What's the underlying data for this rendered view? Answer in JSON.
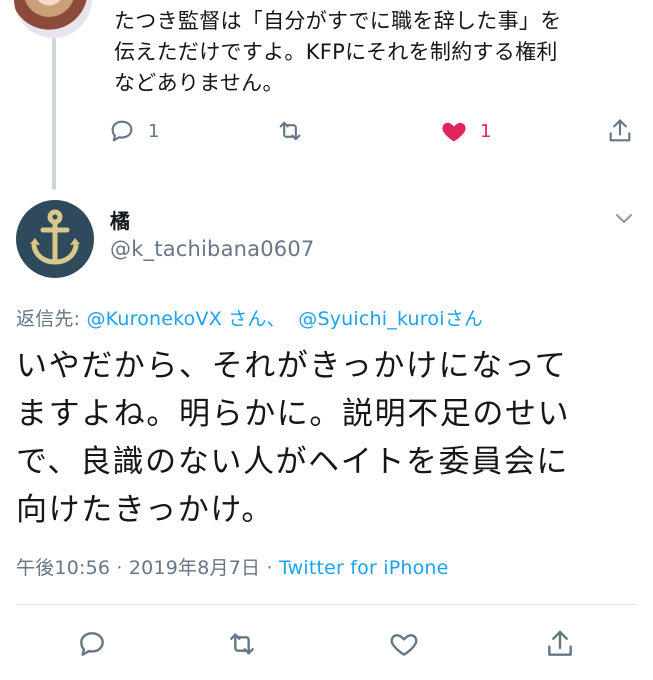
{
  "parent_tweet": {
    "text_line1": "たつき監督は「自分がすでに職を辞した事」を",
    "text_line2": "伝えただけですよ。KFPにそれを制約する権利",
    "text_line3": "などありません。",
    "reply_count": "1",
    "like_count": "1",
    "liked": true
  },
  "tweet": {
    "display_name": "橘",
    "handle": "@k_tachibana0607",
    "reply_to_prefix": "返信先: ",
    "reply_to_user1": "@KuronekoVX さん、",
    "reply_to_user2": "@Syuichi_kuroi",
    "reply_to_suffix": "さん",
    "body_line1": "いやだから、それがきっかけになって",
    "body_line2": "ますよね。明らかに。説明不足のせい",
    "body_line3": "で、良識のない人がヘイトを委員会に",
    "body_line4": "向けたきっかけ。",
    "time": "午後10:56",
    "sep1": " · ",
    "date": "2019年8月7日",
    "sep2": " · ",
    "source": "Twitter for iPhone"
  },
  "icons": {
    "reply": "reply-icon",
    "retweet": "retweet-icon",
    "like": "heart-icon",
    "share": "share-icon",
    "chevron": "chevron-down-icon"
  },
  "colors": {
    "accent": "#1da1f2",
    "muted": "#657786",
    "like": "#e0245e",
    "anchor_avatar": "#2f4a5b",
    "anchor": "#d9c88a"
  }
}
